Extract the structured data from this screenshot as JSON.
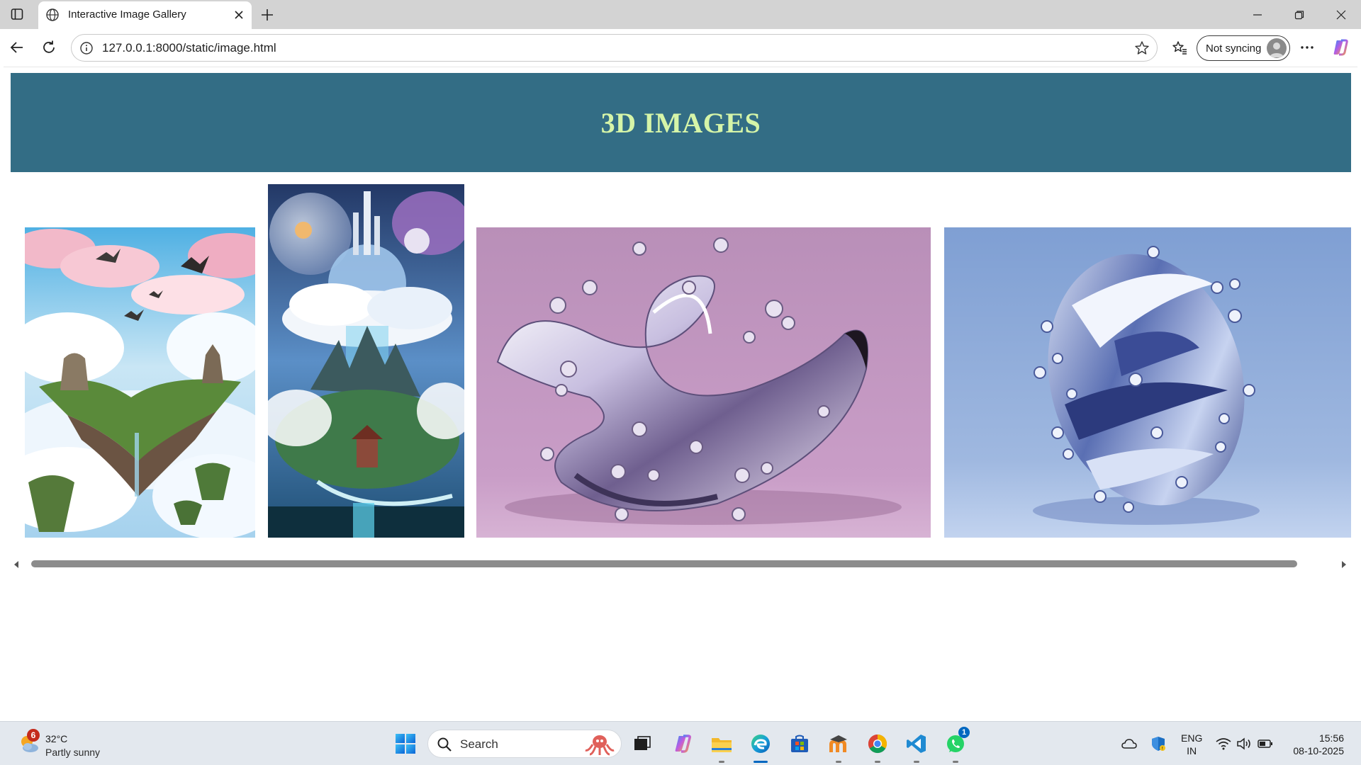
{
  "browser": {
    "tab_title": "Interactive Image Gallery",
    "url": "127.0.0.1:8000/static/image.html",
    "sync_label": "Not syncing"
  },
  "page": {
    "heading": "3D IMAGES",
    "images": [
      {
        "name": "floating-islands-image",
        "theme": "floating islands above clouds with birds"
      },
      {
        "name": "sky-castle-image",
        "theme": "fantasy castle island with planets"
      },
      {
        "name": "chrome-ribbon-pink-image",
        "theme": "chrome ribbon with droplets on pink"
      },
      {
        "name": "chrome-sculpture-blue-image",
        "theme": "chrome swirl sculpture on blue"
      }
    ]
  },
  "taskbar": {
    "weather": {
      "temp": "32°C",
      "condition": "Partly sunny",
      "badge": "6"
    },
    "search_label": "Search",
    "whatsapp_badge": "1",
    "language": {
      "line1": "ENG",
      "line2": "IN"
    },
    "clock": {
      "time": "15:56",
      "date": "08-10-2025"
    }
  },
  "colors": {
    "header_bg": "#336d85",
    "header_text": "#d6f5a8",
    "taskbar_bg": "#e3e8ee",
    "accent": "#0067c0"
  }
}
